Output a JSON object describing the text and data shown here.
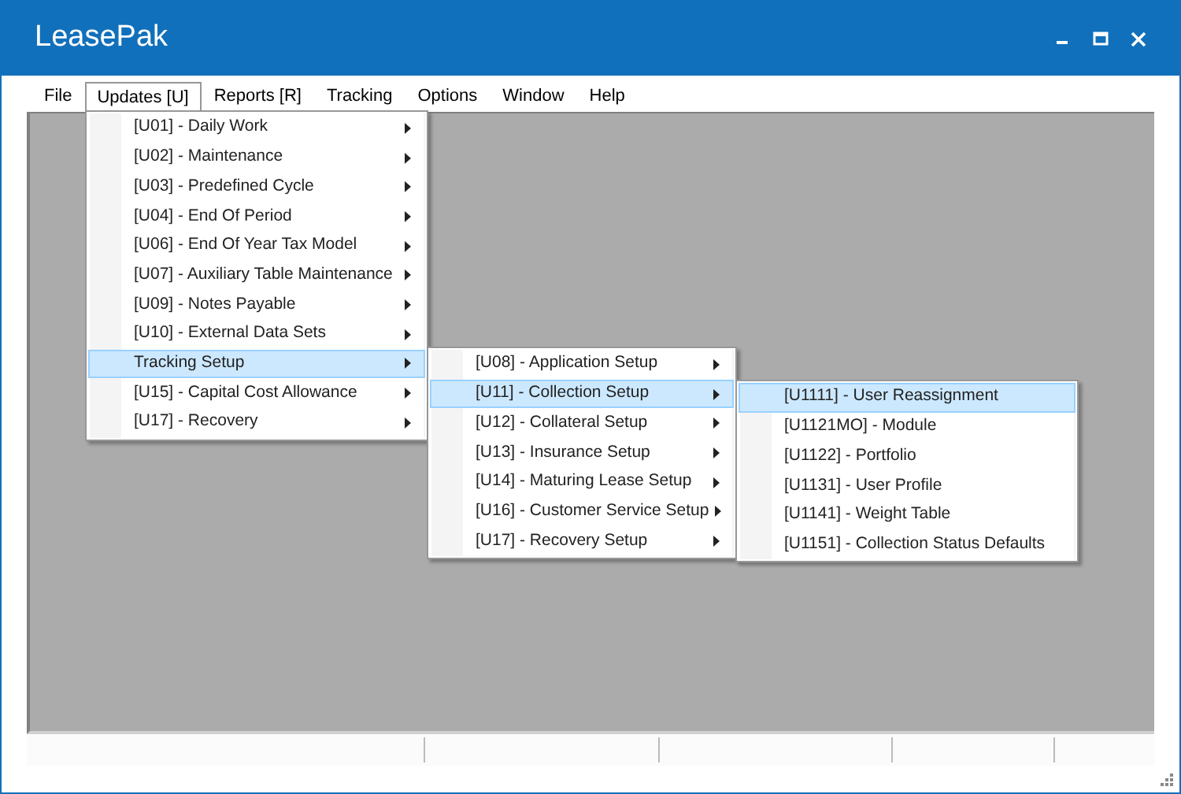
{
  "window": {
    "title": "LeasePak"
  },
  "menu_bar": [
    {
      "label": "File",
      "selected": false
    },
    {
      "label": "Updates [U]",
      "selected": true
    },
    {
      "label": "Reports [R]",
      "selected": false
    },
    {
      "label": "Tracking",
      "selected": false
    },
    {
      "label": "Options",
      "selected": false
    },
    {
      "label": "Window",
      "selected": false
    },
    {
      "label": "Help",
      "selected": false
    }
  ],
  "menus": [
    {
      "items": [
        {
          "label": "[U01] - Daily Work",
          "selected": false,
          "submenu": true
        },
        {
          "label": "[U02] - Maintenance",
          "selected": false,
          "submenu": true
        },
        {
          "label": "[U03] - Predefined Cycle",
          "selected": false,
          "submenu": true
        },
        {
          "label": "[U04] - End Of Period",
          "selected": false,
          "submenu": true
        },
        {
          "label": "[U06] - End Of Year Tax Model",
          "selected": false,
          "submenu": true
        },
        {
          "label": "[U07] - Auxiliary Table Maintenance",
          "selected": false,
          "submenu": true
        },
        {
          "label": "[U09] - Notes Payable",
          "selected": false,
          "submenu": true
        },
        {
          "label": "[U10] - External Data Sets",
          "selected": false,
          "submenu": true
        },
        {
          "label": "Tracking Setup",
          "selected": true,
          "submenu": true
        },
        {
          "label": "[U15] - Capital Cost Allowance",
          "selected": false,
          "submenu": true
        },
        {
          "label": "[U17] - Recovery",
          "selected": false,
          "submenu": true
        }
      ]
    },
    {
      "items": [
        {
          "label": "[U08] - Application Setup",
          "selected": false,
          "submenu": true
        },
        {
          "label": "[U11] - Collection Setup",
          "selected": true,
          "submenu": true
        },
        {
          "label": "[U12] - Collateral Setup",
          "selected": false,
          "submenu": true
        },
        {
          "label": "[U13] - Insurance Setup",
          "selected": false,
          "submenu": true
        },
        {
          "label": "[U14] - Maturing Lease Setup",
          "selected": false,
          "submenu": true
        },
        {
          "label": "[U16] - Customer Service Setup",
          "selected": false,
          "submenu": true
        },
        {
          "label": "[U17] - Recovery Setup",
          "selected": false,
          "submenu": true
        }
      ]
    },
    {
      "items": [
        {
          "label": "[U1111] - User Reassignment",
          "selected": true,
          "submenu": false
        },
        {
          "label": "[U1121MO] - Module",
          "selected": false,
          "submenu": false
        },
        {
          "label": "[U1122] - Portfolio",
          "selected": false,
          "submenu": false
        },
        {
          "label": "[U1131] - User Profile",
          "selected": false,
          "submenu": false
        },
        {
          "label": "[U1141] - Weight Table",
          "selected": false,
          "submenu": false
        },
        {
          "label": "[U1151] - Collection Status Defaults",
          "selected": false,
          "submenu": false
        }
      ]
    }
  ]
}
